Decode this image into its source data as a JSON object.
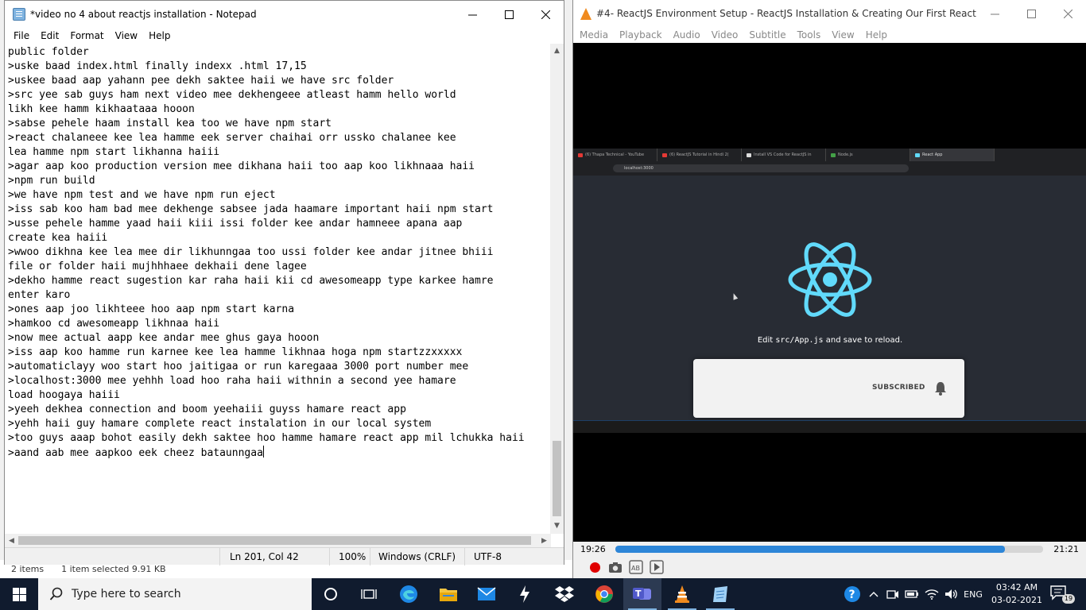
{
  "explorer": {
    "status_items": "2 items",
    "status_selected": "1 item selected  9.91 KB"
  },
  "notepad": {
    "title": "*video no 4 about reactjs installation - Notepad",
    "menu": [
      "File",
      "Edit",
      "Format",
      "View",
      "Help"
    ],
    "lines": [
      "public folder",
      ">uske baad index.html finally indexx .html 17,15",
      ">uskee baad aap yahann pee dekh saktee haii we have src folder",
      ">src yee sab guys ham next video mee dekhengeee atleast hamm hello world",
      "likh kee hamm kikhaataaa hooon",
      ">sabse pehele haam install kea too we have npm start",
      ">react chalaneee kee lea hamme eek server chaihai orr ussko chalanee kee",
      "lea hamme npm start likhanna haiii",
      ">agar aap koo production version mee dikhana haii too aap koo likhnaaa haii",
      ">npm run build",
      ">we have npm test and we have npm run eject",
      ">iss sab koo ham bad mee dekhenge sabsee jada haamare important haii npm start",
      ">usse pehele hamme yaad haii kiii issi folder kee andar hamneee apana aap",
      "create kea haiii",
      ">wwoo dikhna kee lea mee dir likhunngaa too ussi folder kee andar jitnee bhiii",
      "file or folder haii mujhhhaee dekhaii dene lagee",
      ">dekho hamme react sugestion kar raha haii kii cd awesomeapp type karkee hamre",
      "enter karo",
      ">ones aap joo likhteee hoo aap npm start karna",
      ">hamkoo cd awesomeapp likhnaa haii",
      ">now mee actual aapp kee andar mee ghus gaya hooon",
      ">iss aap koo hamme run karnee kee lea hamme likhnaa hoga npm startzzxxxxx",
      ">automaticlayy woo start hoo jaitigaa or run karegaaa 3000 port number mee",
      ">localhost:3000 mee yehhh load hoo raha haii withnin a second yee hamare",
      "load hoogaya haiii",
      ">yeeh dekhea connection and boom yeehaiii guyss hamare react app",
      ">yehh haii guy hamare complete react instalation in our local system",
      ">too guys aaap bohot easily dekh saktee hoo hamme hamare react app mil lchukka haii",
      ">aand aab mee aapkoo eek cheez bataunngaa"
    ],
    "status": {
      "position": "Ln 201, Col 42",
      "zoom": "100%",
      "line_ending": "Windows (CRLF)",
      "encoding": "UTF-8"
    }
  },
  "vlc": {
    "title": "#4- ReactJS Environment Setup - ReactJS Installation & Creating Our First React App in H...",
    "menu": [
      "Media",
      "Playback",
      "Audio",
      "Video",
      "Subtitle",
      "Tools",
      "View",
      "Help"
    ],
    "elapsed": "19:26",
    "total": "21:21",
    "progress_fraction": 0.91,
    "browser": {
      "tabs": [
        {
          "label": "(6) Thapa Technical - YouTube",
          "color": "#e53935"
        },
        {
          "label": "(6) ReactJS Tutorial in Hindi 2(",
          "color": "#e53935"
        },
        {
          "label": "Install VS Code for ReactJS in",
          "color": "#dddddd"
        },
        {
          "label": "Node.js",
          "color": "#43a047"
        },
        {
          "label": "React App",
          "color": "#61dafb"
        }
      ],
      "url": "localhost:3000",
      "edit_prefix": "Edit ",
      "edit_code": "src/App.js",
      "edit_suffix": " and save to reload.",
      "subscribed": "SUBSCRIBED",
      "react_color": "#61dafb"
    }
  },
  "taskbar": {
    "search_placeholder": "Type here to search",
    "language": "ENG",
    "time": "03:42 AM",
    "date": "03-02-2021",
    "notification_count": "19"
  }
}
